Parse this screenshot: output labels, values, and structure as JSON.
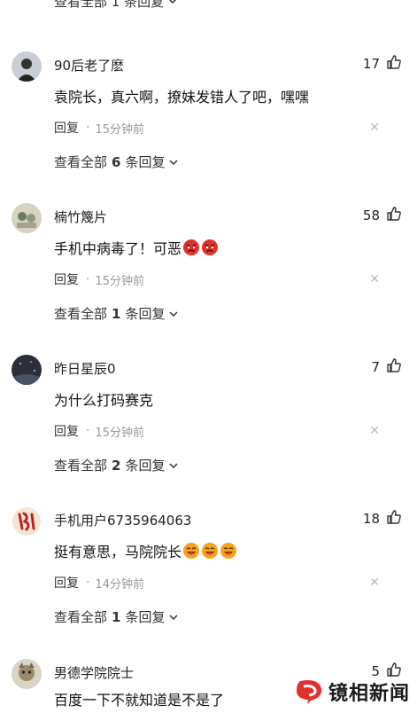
{
  "top_partial": {
    "label": "查看全部 1 条回复"
  },
  "comments": [
    {
      "username": "90后老了麽",
      "likes": "17",
      "text": "袁院长，真六啊，撩妹发错人了吧，嘿嘿",
      "reply_label": "回复",
      "time": "15分钟前",
      "view_all": {
        "prefix": "查看全部",
        "count": "6",
        "suffix": "条回复"
      },
      "emoji": []
    },
    {
      "username": "楠竹篾片",
      "likes": "58",
      "text": "手机中病毒了！可恶",
      "reply_label": "回复",
      "time": "15分钟前",
      "view_all": {
        "prefix": "查看全部",
        "count": "1",
        "suffix": "条回复"
      },
      "emoji": [
        "angry-face-emoji",
        "angry-face-emoji"
      ]
    },
    {
      "username": "昨日星辰0",
      "likes": "7",
      "text": "为什么打码赛克",
      "reply_label": "回复",
      "time": "15分钟前",
      "view_all": {
        "prefix": "查看全部",
        "count": "2",
        "suffix": "条回复"
      },
      "emoji": []
    },
    {
      "username": "手机用户6735964063",
      "likes": "18",
      "text": "挺有意思，马院院长",
      "reply_label": "回复",
      "time": "14分钟前",
      "view_all": {
        "prefix": "查看全部",
        "count": "1",
        "suffix": "条回复"
      },
      "emoji": [
        "laughing-face-emoji",
        "laughing-face-emoji",
        "laughing-face-emoji"
      ]
    },
    {
      "username": "男德学院院士",
      "likes": "5",
      "text": "百度一下不就知道是不是了",
      "emoji": []
    }
  ],
  "watermark": {
    "text": "镜相新闻"
  },
  "colors": {
    "accent_red": "#e0312b",
    "muted": "#999999"
  }
}
